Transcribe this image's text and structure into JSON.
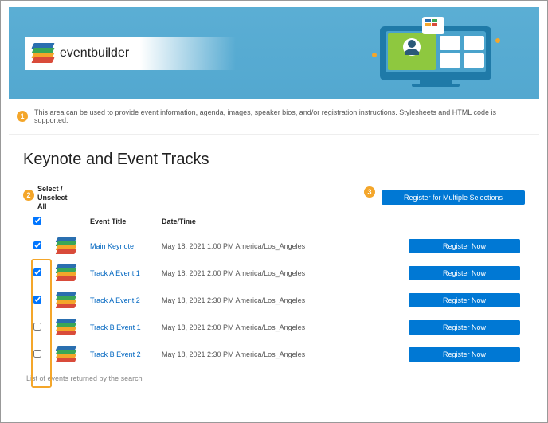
{
  "brand": "eventbuilder",
  "info_text": "This area can be used to provide event information, agenda, images, speaker bios, and/or registration instructions. Stylesheets and HTML code is supported.",
  "heading": "Keynote and Event Tracks",
  "select_label": "Select / Unselect All",
  "register_multi": "Register for Multiple Selections",
  "cols": {
    "title": "Event Title",
    "dt": "Date/Time"
  },
  "rows": [
    {
      "checked": true,
      "title": "Main Keynote",
      "dt": "May 18, 2021 1:00 PM America/Los_Angeles",
      "btn": "Register Now"
    },
    {
      "checked": true,
      "title": "Track A Event 1",
      "dt": "May 18, 2021 2:00 PM America/Los_Angeles",
      "btn": "Register Now"
    },
    {
      "checked": true,
      "title": "Track A Event 2",
      "dt": "May 18, 2021 2:30 PM America/Los_Angeles",
      "btn": "Register Now"
    },
    {
      "checked": false,
      "title": "Track B Event 1",
      "dt": "May 18, 2021 2:00 PM America/Los_Angeles",
      "btn": "Register Now"
    },
    {
      "checked": false,
      "title": "Track B Event 2",
      "dt": "May 18, 2021 2:30 PM America/Los_Angeles",
      "btn": "Register Now"
    }
  ],
  "caption": "List of events returned by the search",
  "badges": {
    "one": "1",
    "two": "2",
    "three": "3"
  }
}
